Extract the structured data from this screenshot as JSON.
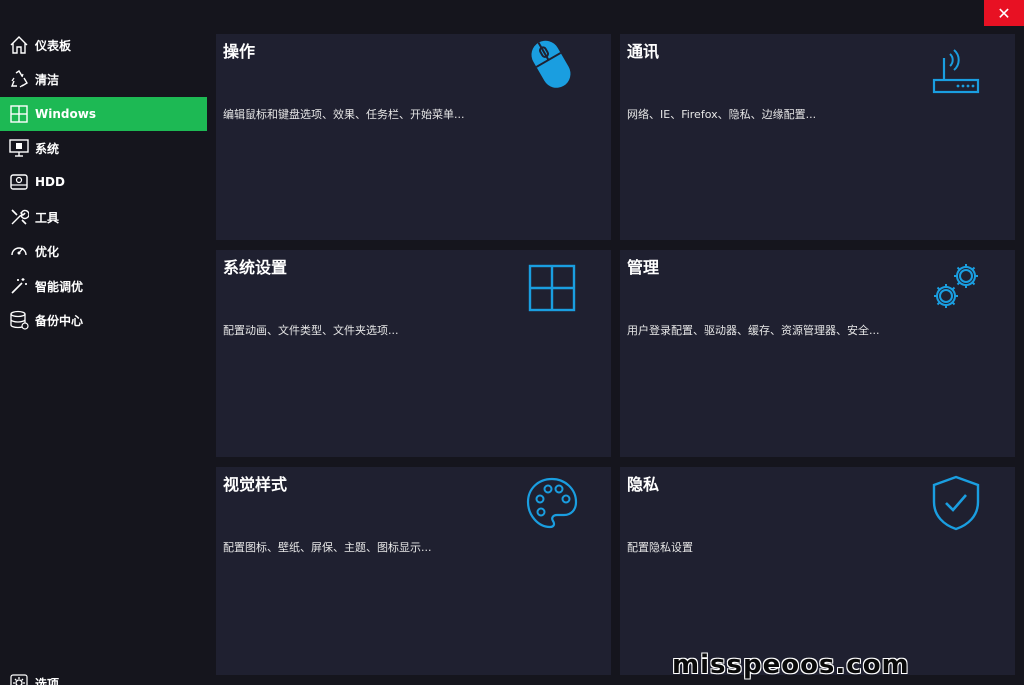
{
  "window": {
    "close_glyph": "✕"
  },
  "sidebar": {
    "items": [
      {
        "label": "仪表板",
        "icon": "home-icon",
        "active": false
      },
      {
        "label": "清洁",
        "icon": "recycle-icon",
        "active": false
      },
      {
        "label": "Windows",
        "icon": "windows-icon",
        "active": true
      },
      {
        "label": "系统",
        "icon": "monitor-icon",
        "active": false
      },
      {
        "label": "HDD",
        "icon": "hard-drive-icon",
        "active": false
      },
      {
        "label": "工具",
        "icon": "tools-icon",
        "active": false
      },
      {
        "label": "优化",
        "icon": "gauge-icon",
        "active": false
      },
      {
        "label": "智能调优",
        "icon": "magic-wand-icon",
        "active": false
      },
      {
        "label": "备份中心",
        "icon": "database-icon",
        "active": false
      }
    ],
    "options_label": "选项"
  },
  "tiles": [
    {
      "title": "操作",
      "description": "编辑鼠标和键盘选项、效果、任务栏、开始菜单...",
      "icon": "mouse-icon"
    },
    {
      "title": "通讯",
      "description": "网络、IE、Firefox、隐私、边缘配置...",
      "icon": "router-icon"
    },
    {
      "title": "系统设置",
      "description": "配置动画、文件类型、文件夹选项...",
      "icon": "windows-logo-icon"
    },
    {
      "title": "管理",
      "description": "用户登录配置、驱动器、缓存、资源管理器、安全...",
      "icon": "gears-icon"
    },
    {
      "title": "视觉样式",
      "description": "配置图标、壁纸、屏保、主题、图标显示...",
      "icon": "palette-icon"
    },
    {
      "title": "隐私",
      "description": "配置隐私设置",
      "icon": "shield-check-icon"
    }
  ],
  "colors": {
    "accent_green": "#1db954",
    "icon_blue": "#1a9ee0",
    "tile_bg": "#1f2030",
    "close_red": "#e81123"
  },
  "watermark": "misspeoos.com"
}
